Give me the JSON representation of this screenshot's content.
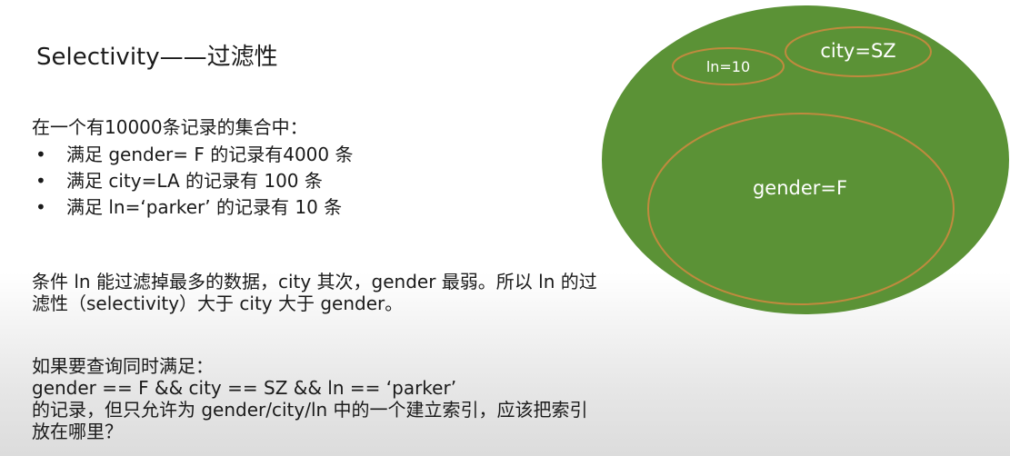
{
  "slide": {
    "title": "Selectivity——过滤性",
    "intro": "在一个有10000条记录的集合中：",
    "bullet_marker": "•",
    "bullets": [
      "满足 gender= F 的记录有4000 条",
      "满足 city=LA 的记录有 100 条",
      "满足 ln=‘parker’ 的记录有 10 条"
    ],
    "conclusion": [
      "条件 ln 能过滤掉最多的数据，city 其次，gender 最弱。所以 ln 的过",
      "滤性（selectivity）大于 city 大于 gender。"
    ],
    "question": [
      "如果要查询同时满足：",
      "gender == F && city == SZ && ln == ‘parker’",
      "的记录，但只允许为 gender/city/ln 中的一个建立索引，应该把索引",
      "放在哪里？"
    ]
  },
  "diagram": {
    "outer_fill": "#5b9236",
    "ring_stroke": "#c08a3e",
    "label_color": "#ffffff",
    "sets": {
      "ln": "ln=10",
      "city": "city=SZ",
      "gender": "gender=F"
    }
  }
}
